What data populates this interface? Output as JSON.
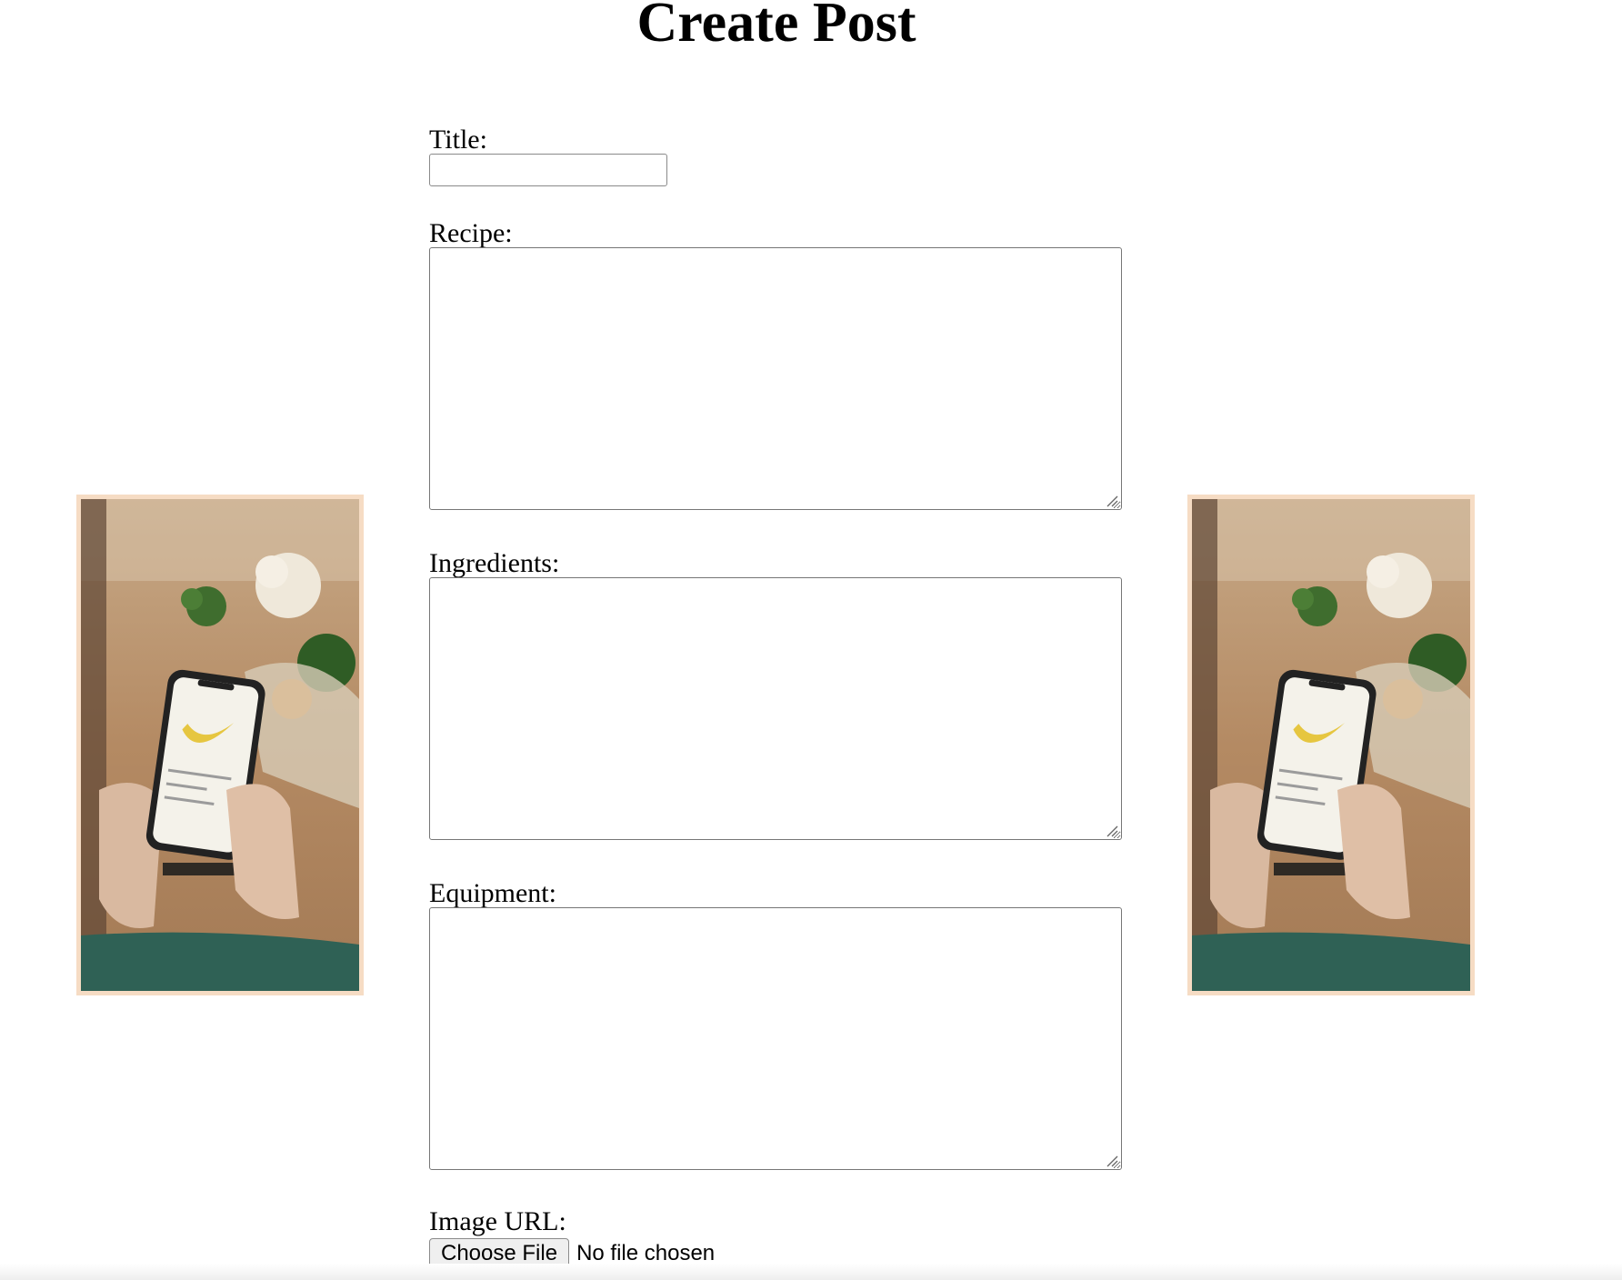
{
  "page": {
    "title": "Create Post"
  },
  "form": {
    "title_label": "Title:",
    "title_value": "",
    "recipe_label": "Recipe:",
    "recipe_value": "",
    "ingredients_label": "Ingredients:",
    "ingredients_value": "",
    "equipment_label": "Equipment:",
    "equipment_value": "",
    "image_label": "Image URL:",
    "file_button_label": "Choose File",
    "file_status": "No file chosen"
  },
  "decor": {
    "photo_subject": "hands-holding-phone-with-banana-on-kitchen-table",
    "photo_border_color": "#f6dcc4"
  }
}
